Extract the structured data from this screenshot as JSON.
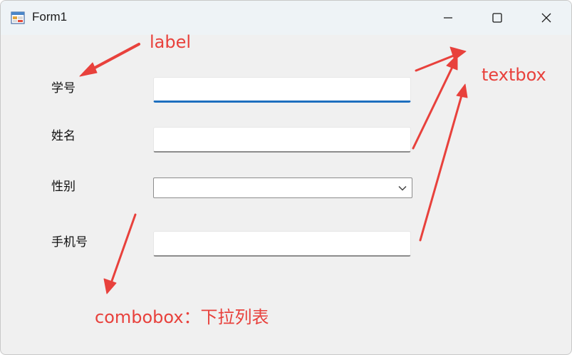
{
  "window": {
    "title": "Form1",
    "controls": {
      "minimize": "minimize-icon",
      "maximize": "maximize-icon",
      "close": "close-icon"
    }
  },
  "form": {
    "labels": {
      "student_id": "学号",
      "name": "姓名",
      "gender": "性别",
      "phone": "手机号"
    },
    "fields": {
      "student_id_value": "",
      "name_value": "",
      "gender_selected": "",
      "phone_value": ""
    }
  },
  "annotations": {
    "label": "label",
    "textbox": "textbox",
    "combobox": "combobox：下拉列表",
    "color": "#e8413c"
  },
  "colors": {
    "focus_underline": "#1e6fbf",
    "form_background": "#f0f0f0",
    "titlebar_background": "#eef3f6"
  }
}
